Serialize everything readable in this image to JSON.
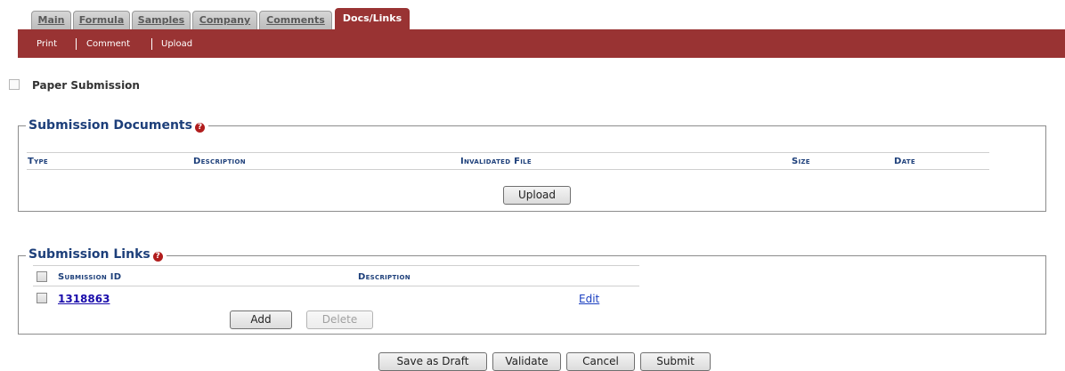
{
  "tabs": [
    {
      "label": "Main"
    },
    {
      "label": "Formula"
    },
    {
      "label": "Samples"
    },
    {
      "label": "Company"
    },
    {
      "label": "Comments"
    },
    {
      "label": "Docs/Links",
      "active": true
    }
  ],
  "toolbar": {
    "print": "Print",
    "comment": "Comment",
    "upload": "Upload"
  },
  "paper_submission": {
    "label": "Paper Submission",
    "checked": false
  },
  "documents": {
    "title": "Submission Documents",
    "help_icon": "question-circle-icon",
    "columns": [
      "Type",
      "Description",
      "Invalidated File",
      "Size",
      "Date"
    ],
    "rows": [],
    "upload_label": "Upload"
  },
  "links": {
    "title": "Submission Links",
    "help_icon": "question-circle-icon",
    "columns": [
      "Submission ID",
      "Description"
    ],
    "rows": [
      {
        "submission_id": "1318863",
        "description": "",
        "edit_label": "Edit"
      }
    ],
    "add_label": "Add",
    "delete_label": "Delete"
  },
  "footer": {
    "save_draft": "Save as Draft",
    "validate": "Validate",
    "cancel": "Cancel",
    "submit": "Submit"
  },
  "colors": {
    "brand_red": "#993333",
    "heading_blue": "#1d3f7a",
    "link_blue": "#1a0dab",
    "help_red": "#b11d1d"
  }
}
